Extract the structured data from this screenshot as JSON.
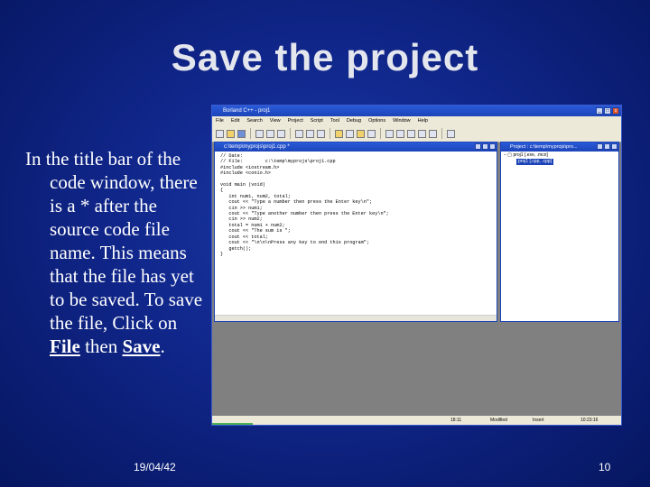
{
  "slide": {
    "title": "Save the project",
    "body_before": "In the title bar of the code window, there is a * after the source code file name.  This means that the file has yet to be saved.  To save the file, Click on ",
    "file_word": "File",
    "then_word": "then",
    "save_word": "Save",
    "period": ".",
    "footer_date": "19/04/42",
    "page_number": "10"
  },
  "ide": {
    "app_title": "Borland C++ - proj1",
    "menu": [
      "File",
      "Edit",
      "Search",
      "View",
      "Project",
      "Script",
      "Tool",
      "Debug",
      "Options",
      "Window",
      "Help"
    ],
    "editor_title": "c:\\temp\\myprojs\\proj1.cpp *",
    "code_lines": [
      "// Date:",
      "// File:        c:\\temp\\myprojs\\proj1.cpp",
      "#include <iostream.h>",
      "#include <conio.h>",
      "",
      "void main (void)",
      "{",
      "   int num1, num2, total;",
      "   cout << \"Type a number then press the Enter key\\n\";",
      "   cin >> num1;",
      "   cout << \"Type another number then press the Enter key\\n\";",
      "   cin >> num2;",
      "   total = num1 + num2;",
      "   cout << \"The sum is \";",
      "   cout << total;",
      "   cout << \"\\n\\n\\nPress any key to end this program\";",
      "   getch();",
      "}"
    ],
    "project_title": "Project : c:\\temp\\myprojs\\pro...",
    "tree_item_1": "proj1 [.exe, .mcn]",
    "tree_item_2": "proj1 [.cpp, .cpp]",
    "status_pos": "18:11",
    "status_mode": "Modified",
    "status_insert": "Insert",
    "status_time": "10:23:16"
  },
  "colors": {
    "background": "#10268a",
    "title_text": "#e4e6ee",
    "window_title": "#1c44b8"
  }
}
